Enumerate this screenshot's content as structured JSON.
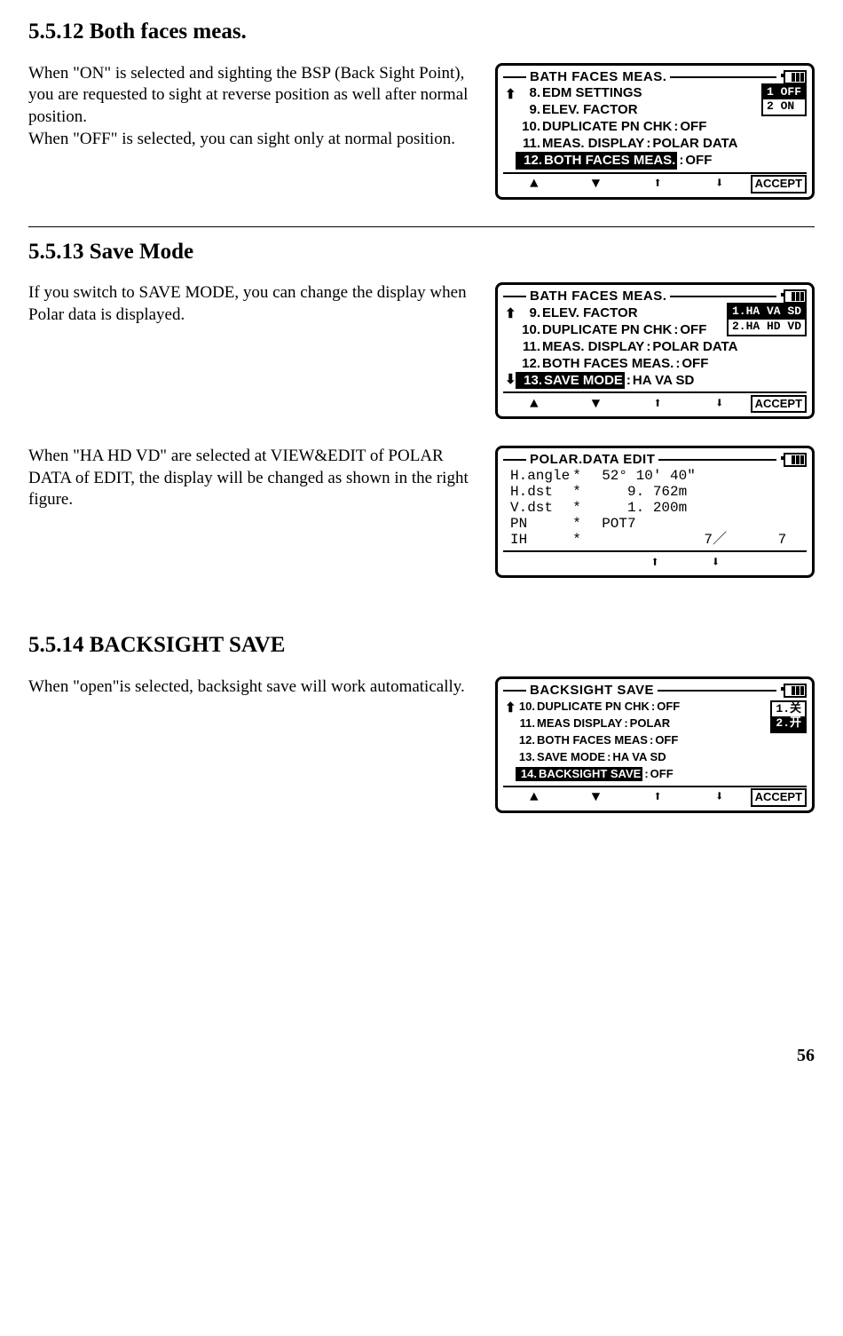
{
  "page_number": "56",
  "sections": [
    {
      "heading": "5.5.12 Both faces meas.",
      "body": "When \"ON\" is selected and sighting the BSP (Back Sight Point), you are requested to sight at reverse position as well after normal position.\nWhen \"OFF\" is selected, you can sight only at normal position.",
      "lcd": {
        "title": "BATH FACES MEAS.",
        "scroll_up": true,
        "scroll_down": false,
        "battery": true,
        "rows": [
          {
            "num": "8.",
            "label": "EDM SETTINGS",
            "colon": false,
            "val": ""
          },
          {
            "num": "9.",
            "label": "ELEV. FACTOR",
            "colon": false,
            "val": ""
          },
          {
            "num": "10.",
            "label": "DUPLICATE PN CHK",
            "colon": true,
            "val": "OFF"
          },
          {
            "num": "11.",
            "label": "MEAS. DISPLAY",
            "colon": true,
            "val": "POLAR DATA"
          },
          {
            "num": "12.",
            "label": "BOTH FACES MEAS.",
            "colon": true,
            "val": "OFF",
            "selected": true
          }
        ],
        "options": [
          {
            "label": "1 OFF",
            "selected": true
          },
          {
            "label": "2 ON",
            "selected": false
          }
        ],
        "softkeys": [
          "▲",
          "▼",
          "⬆",
          "⬇"
        ],
        "accept": "ACCEPT"
      }
    },
    {
      "heading": "5.5.13 Save Mode",
      "body": "If you switch to SAVE MODE, you can change the display when Polar data is displayed.",
      "lcd": {
        "title": "BATH FACES MEAS.",
        "scroll_up": true,
        "scroll_down": true,
        "battery": true,
        "rows": [
          {
            "num": "9.",
            "label": "ELEV. FACTOR",
            "colon": false,
            "val": ""
          },
          {
            "num": "10.",
            "label": "DUPLICATE PN CHK",
            "colon": true,
            "val": "OFF"
          },
          {
            "num": "11.",
            "label": "MEAS. DISPLAY",
            "colon": true,
            "val": "POLAR DATA"
          },
          {
            "num": "12.",
            "label": "BOTH FACES MEAS.",
            "colon": true,
            "val": "OFF"
          },
          {
            "num": "13.",
            "label": "SAVE MODE",
            "colon": true,
            "val": "HA VA SD",
            "selected": true
          }
        ],
        "options": [
          {
            "label": "1.HA VA SD",
            "selected": true
          },
          {
            "label": "2.HA HD VD",
            "selected": false
          }
        ],
        "softkeys": [
          "▲",
          "▼",
          "⬆",
          "⬇"
        ],
        "accept": "ACCEPT"
      }
    },
    {
      "heading": "",
      "body": "When \"HA HD VD\" are selected at VIEW&EDIT of POLAR DATA of EDIT, the display will be changed as shown in the right figure.",
      "lcd_polar": {
        "title": "POLAR.DATA EDIT",
        "battery": true,
        "rows": [
          {
            "c1": "H.angle",
            "c2": "*",
            "c3": "  52° 10′ 40″"
          },
          {
            "c1": "H.dst",
            "c2": "*",
            "c3": "     9. 762m"
          },
          {
            "c1": "V.dst",
            "c2": "*",
            "c3": "     1. 200m"
          },
          {
            "c1": "PN",
            "c2": "*",
            "c3": "  POT7"
          },
          {
            "c1": "IH",
            "c2": "*",
            "c3": "              7／      7"
          }
        ],
        "softkeys": [
          "",
          "",
          "⬆",
          "⬇",
          ""
        ]
      }
    },
    {
      "heading": "5.5.14 BACKSIGHT SAVE",
      "body": "When \"open\"is selected, backsight save will work automatically.",
      "lcd": {
        "title": "BACKSIGHT SAVE",
        "scroll_up": true,
        "scroll_down": false,
        "battery": true,
        "rows": [
          {
            "num": "10.",
            "label": "DUPLICATE PN CHK",
            "colon": true,
            "val": "OFF"
          },
          {
            "num": "11.",
            "label": "MEAS DISPLAY",
            "colon": true,
            "val": "POLAR"
          },
          {
            "num": "12.",
            "label": "BOTH FACES MEAS",
            "colon": true,
            "val": "OFF"
          },
          {
            "num": "13.",
            "label": "SAVE MODE",
            "colon": true,
            "val": "HA  VA  SD"
          },
          {
            "num": "14.",
            "label": "BACKSIGHT SAVE",
            "colon": true,
            "val": "OFF",
            "selected": true
          }
        ],
        "options": [
          {
            "label": "1.关",
            "selected": false
          },
          {
            "label": "2.开",
            "selected": true
          }
        ],
        "softkeys": [
          "▲",
          "▼",
          "⬆",
          "⬇"
        ],
        "accept": "ACCEPT"
      }
    }
  ]
}
